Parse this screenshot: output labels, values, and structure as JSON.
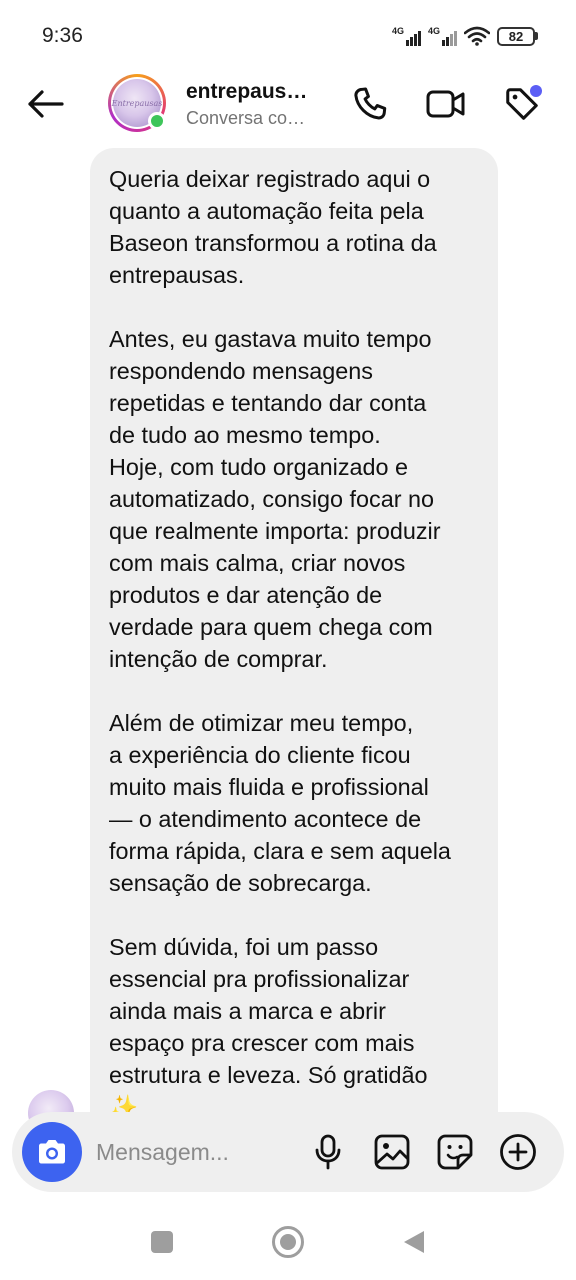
{
  "status_bar": {
    "time": "9:36",
    "network_1": "4G",
    "network_2": "4G",
    "battery_level": "82"
  },
  "header": {
    "contact_name": "entrepaus…",
    "contact_subtitle": "Conversa co…",
    "avatar_logo_text": "Entrepausas",
    "online": true,
    "icons": [
      "back-arrow-icon",
      "phone-icon",
      "video-camera-icon",
      "tag-icon"
    ],
    "accent_color": "#5b5ef5"
  },
  "message": {
    "paragraphs": [
      [
        "Queria deixar registrado aqui o",
        "quanto a automação feita pela",
        "Baseon transformou a rotina da",
        "entrepausas."
      ],
      [
        "Antes, eu gastava muito tempo",
        "respondendo mensagens",
        "repetidas e tentando dar conta",
        "de tudo ao mesmo tempo.",
        "Hoje, com tudo organizado e",
        "automatizado, consigo focar no",
        "que realmente importa: produzir",
        "com mais calma, criar novos",
        "produtos e dar atenção de",
        "verdade para quem chega com",
        "intenção de comprar."
      ],
      [
        "Além de otimizar meu tempo,",
        "a experiência do cliente ficou",
        "muito mais fluida e profissional",
        "— o atendimento acontece de",
        "forma rápida, clara e sem aquela",
        "sensação de sobrecarga."
      ],
      [
        "Sem dúvida, foi um passo",
        "essencial pra profissionalizar",
        "ainda mais a marca e abrir",
        "espaço pra crescer com mais",
        "estrutura e leveza. Só gratidão",
        "✨"
      ]
    ]
  },
  "composer": {
    "placeholder": "Mensagem...",
    "value": "",
    "camera_color": "#3d63f0",
    "icons": [
      "camera-icon",
      "microphone-icon",
      "gallery-icon",
      "sticker-icon",
      "plus-icon"
    ]
  },
  "nav_bar": {
    "icons": [
      "recents-icon",
      "home-icon",
      "back-icon"
    ]
  }
}
